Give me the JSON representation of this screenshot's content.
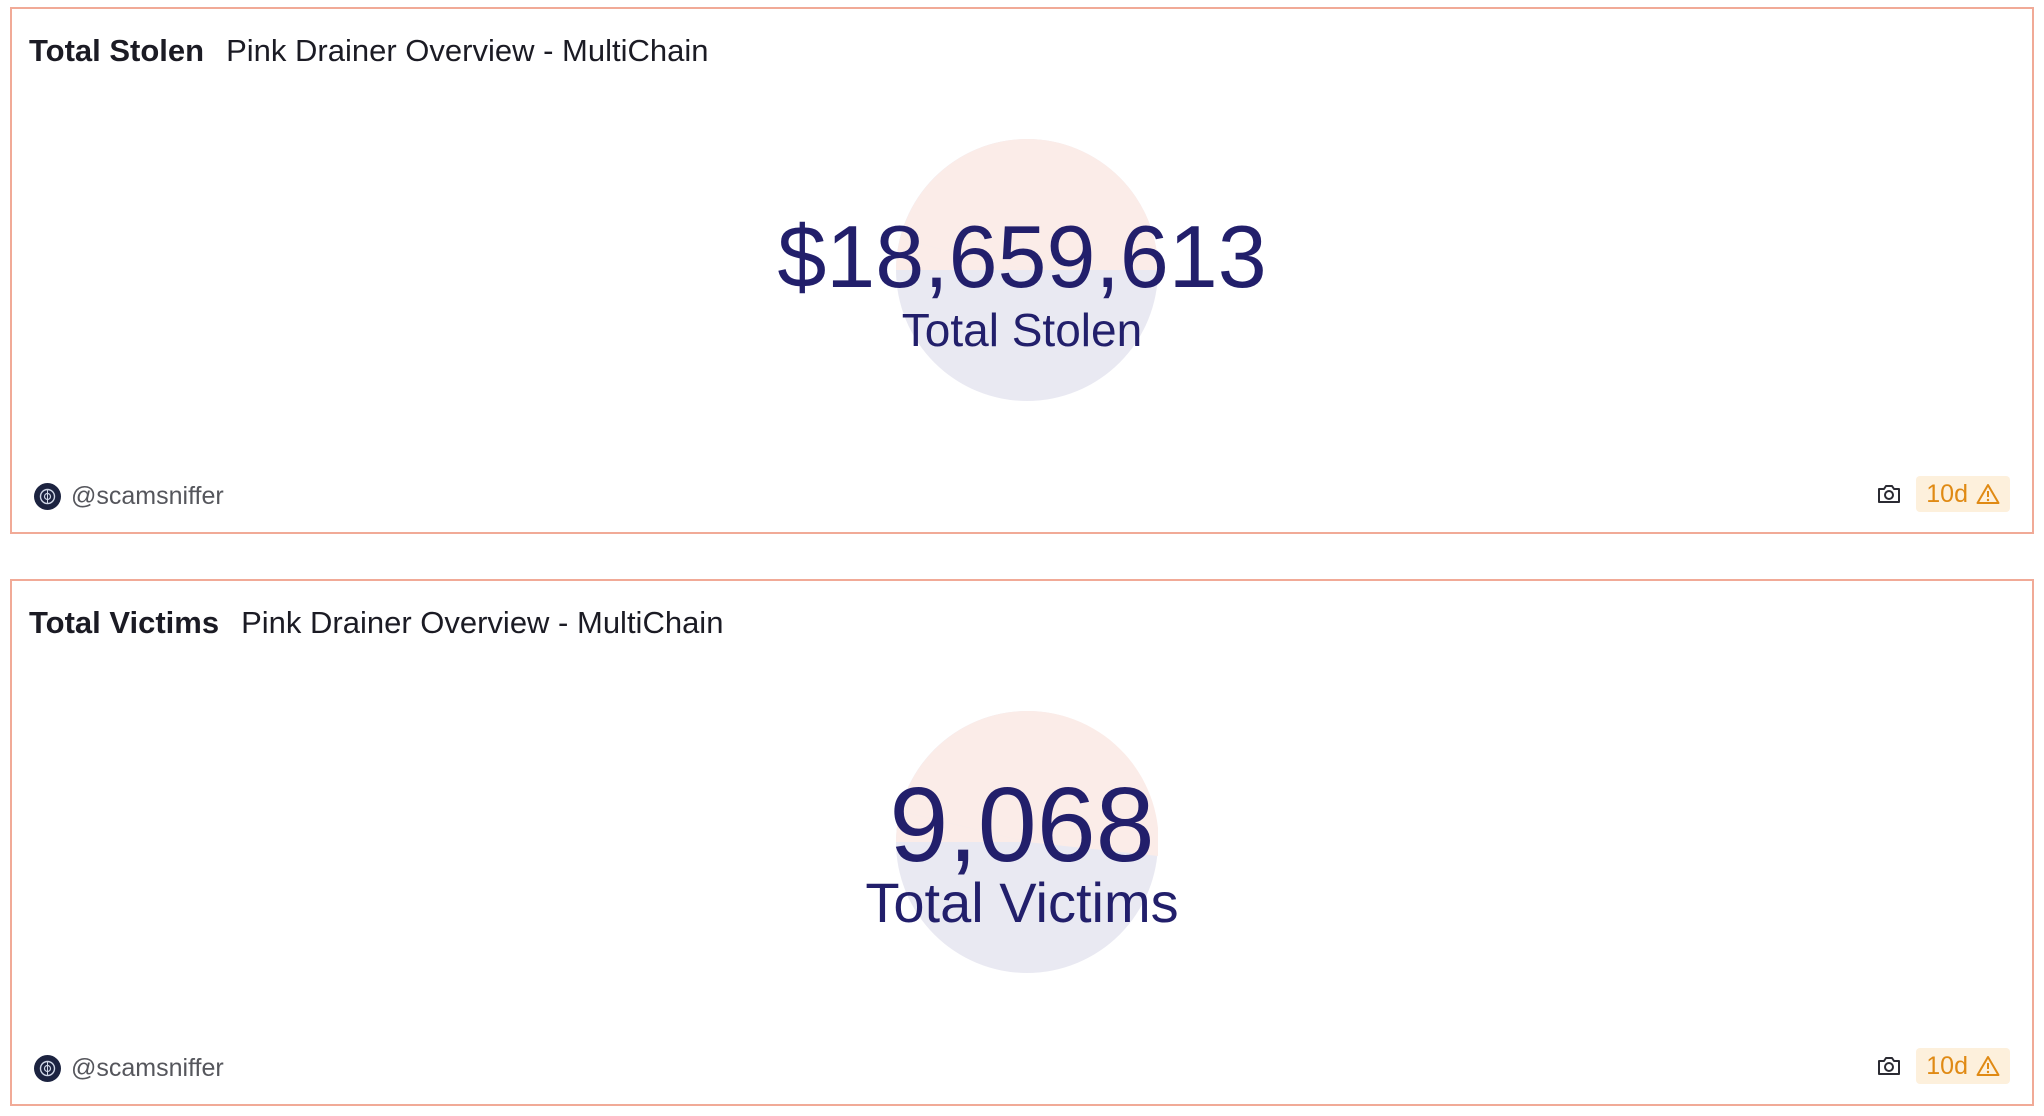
{
  "widgets": [
    {
      "title": "Total Stolen",
      "dashboard": "Pink Drainer Overview - MultiChain",
      "value": "$18,659,613",
      "label": "Total Stolen",
      "author": "@scamsniffer",
      "freshness": "10d",
      "icons": [
        "avatar-icon",
        "camera-icon",
        "warning-icon"
      ]
    },
    {
      "title": "Total Victims",
      "dashboard": "Pink Drainer Overview - MultiChain",
      "value": "9,068",
      "label": "Total Victims",
      "author": "@scamsniffer",
      "freshness": "10d",
      "icons": [
        "avatar-icon",
        "camera-icon",
        "warning-icon"
      ]
    }
  ],
  "colors": {
    "border": "#f1aa97",
    "counter_text": "#221f6b",
    "pie_top": "#fbece8",
    "pie_bottom": "#e9e9f2",
    "badge_bg": "#fdf0dc",
    "badge_text": "#e08a14"
  }
}
